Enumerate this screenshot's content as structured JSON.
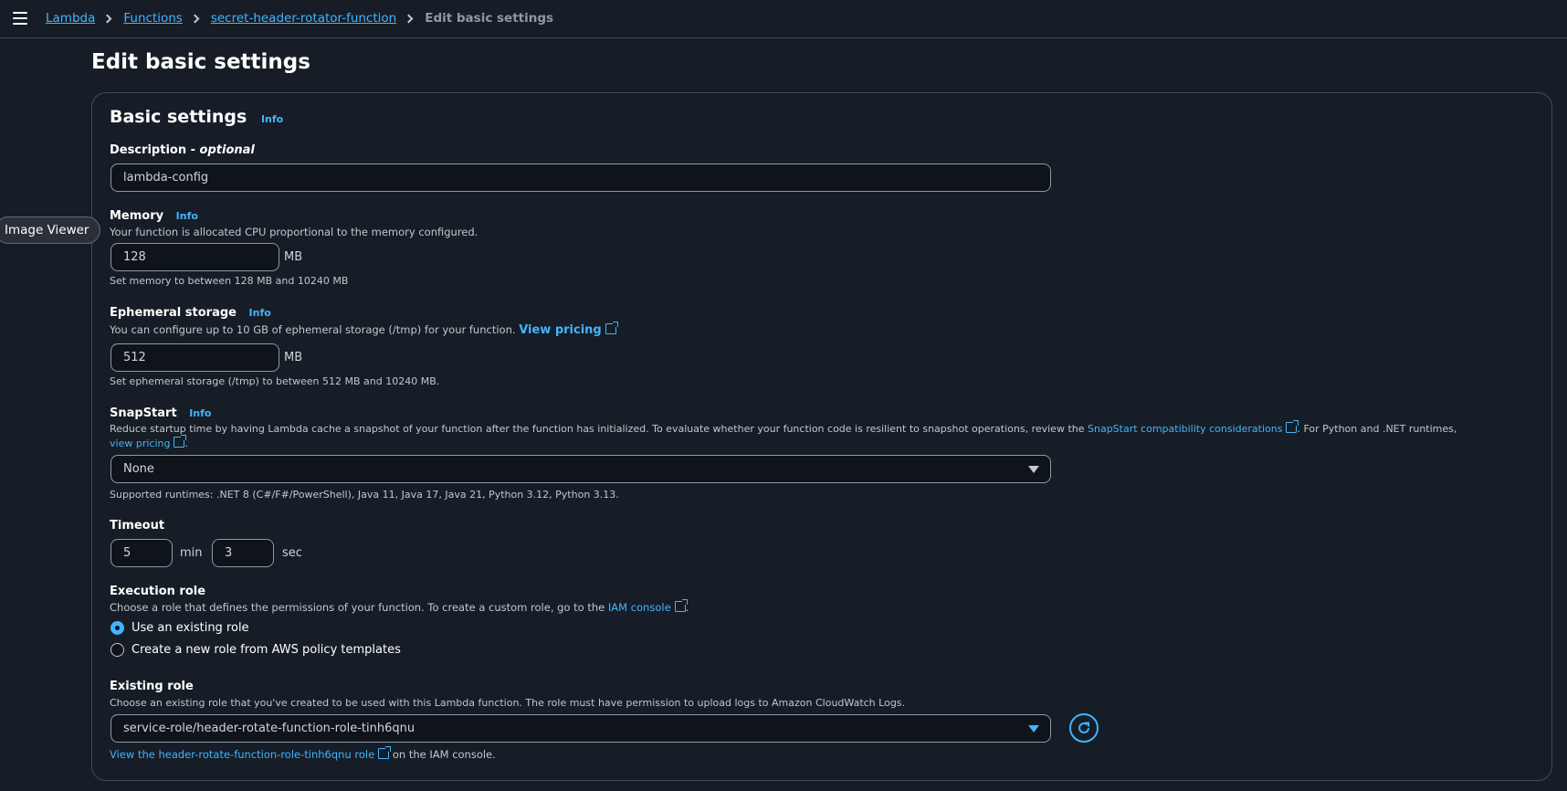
{
  "breadcrumb": {
    "items": [
      "Lambda",
      "Functions",
      "secret-header-rotator-function"
    ],
    "current": "Edit basic settings"
  },
  "page": {
    "title": "Edit basic settings"
  },
  "tooltip": "Image Viewer",
  "basic_settings": {
    "title": "Basic settings",
    "info": "Info",
    "description": {
      "label": "Description - ",
      "optional": "optional",
      "value": "lambda-config"
    },
    "memory": {
      "label": "Memory",
      "info": "Info",
      "desc": "Your function is allocated CPU proportional to the memory configured.",
      "value": "128",
      "unit": "MB",
      "hint": "Set memory to between 128 MB and 10240 MB"
    },
    "ephemeral": {
      "label": "Ephemeral storage",
      "info": "Info",
      "desc": "You can configure up to 10 GB of ephemeral storage (/tmp) for your function.",
      "link": "View pricing",
      "value": "512",
      "unit": "MB",
      "hint": "Set ephemeral storage (/tmp) to between 512 MB and 10240 MB."
    },
    "snapstart": {
      "label": "SnapStart",
      "info": "Info",
      "desc_1": "Reduce startup time by having Lambda cache a snapshot of your function after the function has initialized. To evaluate whether your function code is resilient to snapshot operations, review the",
      "link_1": "SnapStart compatibility considerations",
      "desc_2": ". For Python and .NET runtimes,",
      "link_2a": "view",
      "link_2b": "pricing",
      "desc_3": ".",
      "selected": "None",
      "hint": "Supported runtimes: .NET 8 (C#/F#/PowerShell), Java 11, Java 17, Java 21, Python 3.12, Python 3.13."
    },
    "timeout": {
      "label": "Timeout",
      "min_value": "5",
      "min_unit": "min",
      "sec_value": "3",
      "sec_unit": "sec"
    },
    "execution_role": {
      "label": "Execution role",
      "desc": "Choose a role that defines the permissions of your function. To create a custom role, go to the",
      "link": "IAM console",
      "desc_end": ".",
      "options": [
        "Use an existing role",
        "Create a new role from AWS policy templates"
      ],
      "selected_index": 0
    },
    "existing_role": {
      "label": "Existing role",
      "desc": "Choose an existing role that you've created to be used with this Lambda function. The role must have permission to upload logs to Amazon CloudWatch Logs.",
      "selected": "service-role/header-rotate-function-role-tinh6qnu",
      "view_link": "View the header-rotate-function-role-tinh6qnu role",
      "view_suffix": "on the IAM console."
    }
  },
  "colors": {
    "accent": "#42b4ff",
    "background": "#161d26",
    "border": "#414d5c"
  }
}
